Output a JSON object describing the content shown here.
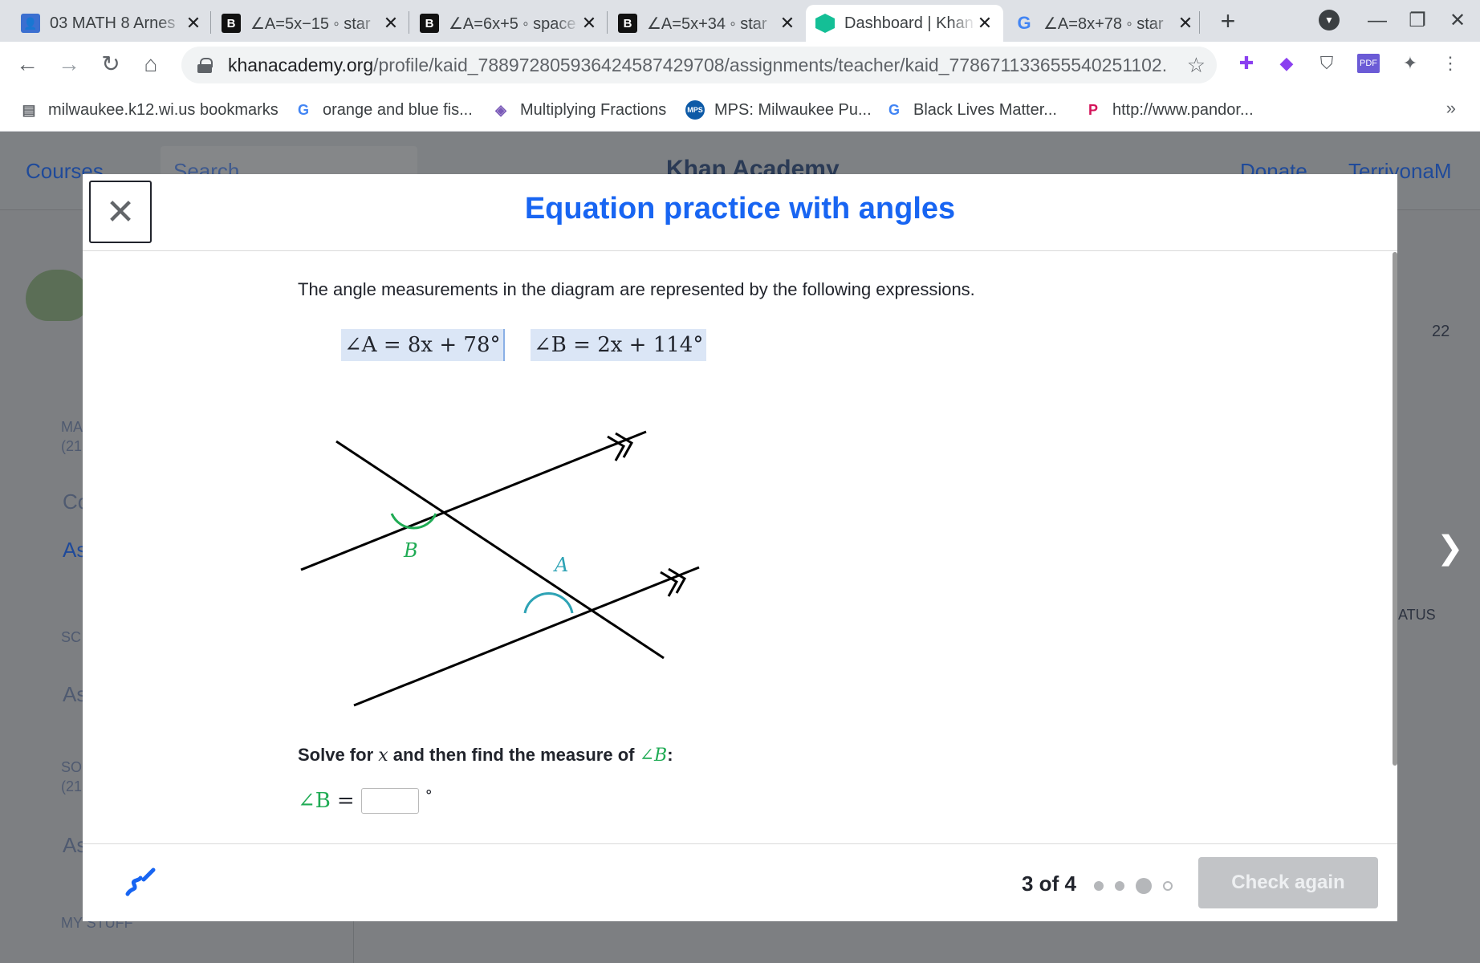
{
  "browser": {
    "tabs": [
      {
        "title": "03 MATH 8 Arnes",
        "favicon": "classroom-icon"
      },
      {
        "title": "∠A=5x−15 ◦ star",
        "favicon": "b-icon"
      },
      {
        "title": "∠A=6x+5 ◦ space",
        "favicon": "b-icon"
      },
      {
        "title": "∠A=5x+34 ◦ star",
        "favicon": "b-icon"
      },
      {
        "title": "Dashboard | Khan",
        "favicon": "khan-academy-icon"
      },
      {
        "title": "∠A=8x+78 ◦ star",
        "favicon": "google-icon"
      }
    ],
    "active_tab_index": 4,
    "url_domain": "khanacademy.org",
    "url_path": "/profile/kaid_788972805936424587429708/assignments/teacher/kaid_778671133655540251102...",
    "bookmarks": [
      {
        "label": "milwaukee.k12.wi.us bookmarks",
        "icon": "folder-icon"
      },
      {
        "label": "orange and blue fis...",
        "icon": "google-icon"
      },
      {
        "label": "Multiplying Fractions",
        "icon": "cube-icon"
      },
      {
        "label": "MPS: Milwaukee Pu...",
        "icon": "mps-icon"
      },
      {
        "label": "Black Lives Matter...",
        "icon": "google-icon"
      },
      {
        "label": "http://www.pandor...",
        "icon": "pandora-icon"
      }
    ]
  },
  "background_page": {
    "courses": "Courses",
    "search": "Search",
    "logo": "Khan Academy",
    "donate": "Donate",
    "username": "TerriyonaM",
    "stat": "22",
    "status_header": "ATUS",
    "sidebar_fragments": [
      "MA",
      "(21",
      "Co",
      "As",
      "SC",
      "As",
      "SO",
      "(21",
      "As",
      "MY STUFF"
    ]
  },
  "modal": {
    "title": "Equation practice with angles",
    "intro": "The angle measurements in the diagram are represented by the following expressions.",
    "expr_a": "∠A = 8x + 78°",
    "expr_b": "∠B = 2x + 114°",
    "diagram_labels": {
      "a": "A",
      "b": "B"
    },
    "prompt_pre": "Solve for ",
    "prompt_var": "x",
    "prompt_mid": " and then find the measure of ",
    "prompt_angle": "∠B",
    "prompt_post": ":",
    "answer_label": "∠B",
    "answer_eq": "=",
    "answer_value": "",
    "answer_unit": "°",
    "progress": "3 of 4",
    "progress_dots": [
      "done",
      "done",
      "current",
      "todo"
    ],
    "check_button": "Check again"
  },
  "colors": {
    "title_blue": "#1865f2",
    "green": "#1fab54",
    "angle_b_arc": "#1fab54",
    "angle_a_arc": "#2ea3b5"
  }
}
